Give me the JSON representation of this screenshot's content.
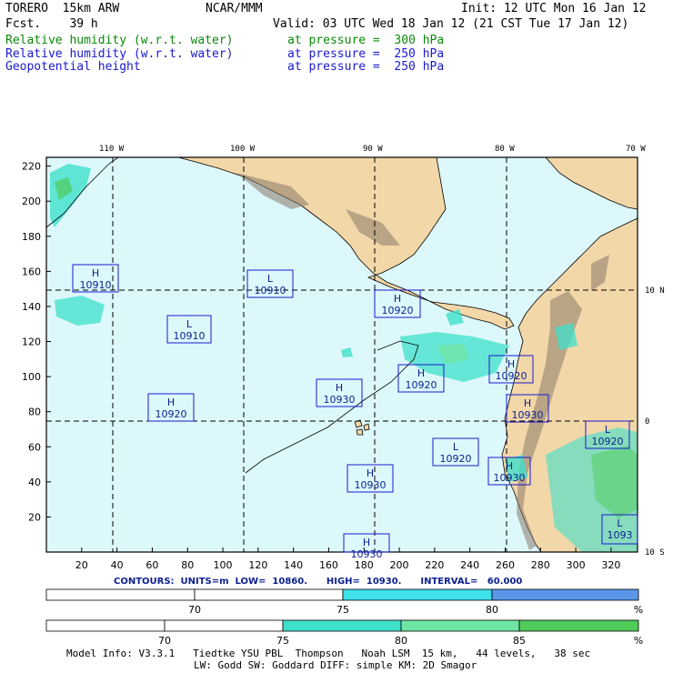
{
  "header": {
    "model": "TORERO  15km ARW",
    "org": "NCAR/MMM",
    "init": "Init: 12 UTC Mon 16 Jan 12",
    "fcst": "Fcst.    39 h",
    "valid": "Valid: 03 UTC Wed 18 Jan 12 (21 CST Tue 17 Jan 12)",
    "fields": [
      {
        "name": "Relative humidity (w.r.t. water)",
        "level": "at pressure =  300 hPa",
        "color": "#0a8a0a"
      },
      {
        "name": "Relative humidity (w.r.t. water)",
        "level": "at pressure =  250 hPa",
        "color": "#1a1ad0"
      },
      {
        "name": "Geopotential height",
        "level": "at pressure =  250 hPa",
        "color": "#1a1ad0"
      }
    ]
  },
  "map": {
    "lon_labels": [
      "110 W",
      "100 W",
      "90 W",
      "80 W",
      "70 W"
    ],
    "lat_labels": [
      "10 N",
      "0",
      "10 S"
    ],
    "x_ticks": [
      "20",
      "40",
      "60",
      "80",
      "100",
      "120",
      "140",
      "160",
      "180",
      "200",
      "220",
      "240",
      "260",
      "280",
      "300",
      "320"
    ],
    "y_ticks": [
      "220",
      "200",
      "180",
      "160",
      "140",
      "120",
      "100",
      "80",
      "60",
      "40",
      "20"
    ],
    "colors": {
      "ocean": "#dcf8fb",
      "land": "#f2d7a8",
      "terrain": "#8c7a6a",
      "border": "#000000",
      "box": "#1a1ad0",
      "grid": "#000000"
    },
    "centers": [
      {
        "letter": "H",
        "value": "10910"
      },
      {
        "letter": "L",
        "value": "10910"
      },
      {
        "letter": "L",
        "value": "10910"
      },
      {
        "letter": "H",
        "value": "10920"
      },
      {
        "letter": "H",
        "value": "10920"
      },
      {
        "letter": "H",
        "value": "10930"
      },
      {
        "letter": "H",
        "value": "10930"
      },
      {
        "letter": "H",
        "value": "10920"
      },
      {
        "letter": "H",
        "value": "10930"
      },
      {
        "letter": "L",
        "value": "10920"
      },
      {
        "letter": "H",
        "value": "10920"
      },
      {
        "letter": "H",
        "value": "10930"
      },
      {
        "letter": "L",
        "value": "10920"
      },
      {
        "letter": "H",
        "value": "10930"
      },
      {
        "letter": "L",
        "value": "1093"
      }
    ]
  },
  "contours_text": "CONTOURS:  UNITS=m  LOW=  10860.      HIGH=  10930.      INTERVAL=   60.000",
  "colorbar_250": {
    "labels": [
      "70",
      "75",
      "80",
      "%"
    ],
    "colors": [
      "#ffffff",
      "#ffffff",
      "#3ee0ea",
      "#5b97e8"
    ]
  },
  "colorbar_300": {
    "labels": [
      "70",
      "75",
      "80",
      "85",
      "%"
    ],
    "colors": [
      "#ffffff",
      "#ffffff",
      "#3ee0ca",
      "#6ee6a4",
      "#4fcc5a"
    ]
  },
  "footer": {
    "line1": "Model Info: V3.3.1   Tiedtke YSU PBL  Thompson   Noah LSM  15 km,   44 levels,   38 sec",
    "line2": "LW: Godd SW: Goddard DIFF: simple KM: 2D Smagor"
  }
}
